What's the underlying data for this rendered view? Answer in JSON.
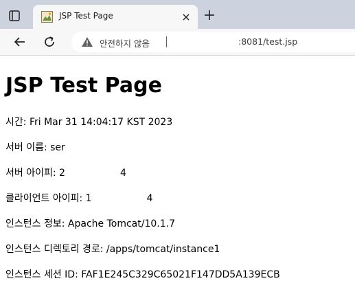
{
  "browser": {
    "tab": {
      "title": "JSP Test Page"
    },
    "omnibox": {
      "security_label": "안전하지 않음",
      "url": ":8081/test.jsp"
    },
    "icons": {
      "tab_actions": "tab-actions-icon",
      "favicon": "image-favicon-icon",
      "close": "close-icon",
      "new_tab": "plus-icon",
      "back": "back-arrow-icon",
      "reload": "reload-icon",
      "warning": "warning-icon"
    }
  },
  "page": {
    "title": "JSP Test Page",
    "lines": [
      {
        "label": "시간:",
        "value": "Fri Mar 31 14:04:17 KST 2023"
      },
      {
        "label": "서버 이름:",
        "value": "ser"
      },
      {
        "label": "서버 아이피:",
        "value": "2                  4"
      },
      {
        "label": "클라이언트 아이피:",
        "value": "1                  4"
      },
      {
        "label": "인스턴스 정보:",
        "value": "Apache Tomcat/10.1.7"
      },
      {
        "label": "인스턴스 디렉토리 경로:",
        "value": "/apps/tomcat/instance1"
      },
      {
        "label": "인스턴스 세션 ID:",
        "value": "FAF1E245C329C65021F147DD5A139ECB"
      }
    ]
  }
}
